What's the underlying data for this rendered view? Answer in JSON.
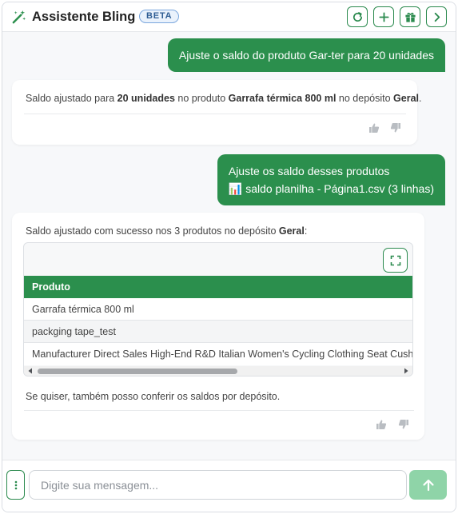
{
  "header": {
    "title": "Assistente Bling",
    "badge": "BETA",
    "icons": [
      "magic-wand-icon",
      "refresh-icon",
      "plus-icon",
      "gift-icon",
      "chevron-right-icon"
    ]
  },
  "messages": {
    "user1": "Ajuste o saldo do produto Gar-ter para 20 unidades",
    "bot1": {
      "prefix": "Saldo ajustado para ",
      "qty": "20 unidades",
      "mid": " no produto ",
      "product": "Garrafa térmica 800 ml",
      "mid2": " no depósito ",
      "warehouse": "Geral",
      "suffix": "."
    },
    "user2": {
      "line1": "Ajuste os saldo desses produtos",
      "file_icon": "📊",
      "file": "saldo planilha - Página1.csv (3 linhas)"
    },
    "bot2": {
      "prefix": "Saldo ajustado com sucesso nos 3 produtos no depósito ",
      "warehouse": "Geral",
      "suffix": ":",
      "table": {
        "header": "Produto",
        "rows": [
          "Garrafa térmica 800 ml",
          "packging tape_test",
          "Manufacturer Direct Sales High-End R&D Italian Women's Cycling Clothing Seat Cushion"
        ]
      },
      "footer": "Se quiser, também posso conferir os saldos por depósito."
    }
  },
  "input": {
    "placeholder": "Digite sua mensagem..."
  },
  "colors": {
    "accent": "#2b8f4d",
    "send_disabled": "#8fd4a8"
  }
}
